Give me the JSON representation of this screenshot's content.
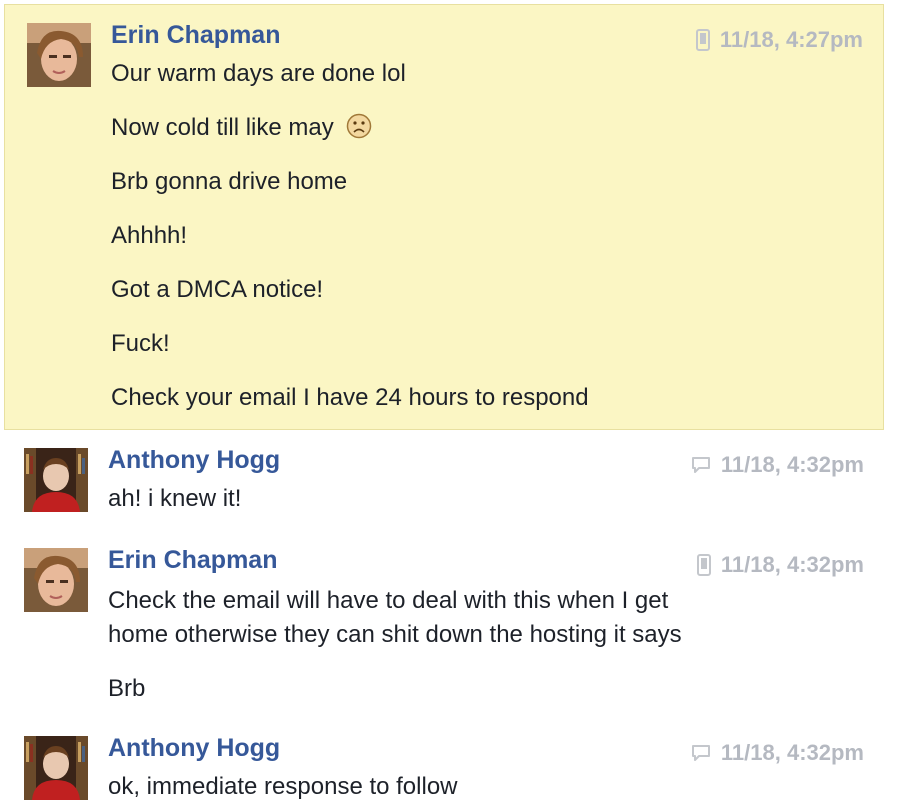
{
  "messages": [
    {
      "author": "Erin Chapman",
      "time": "11/18, 4:27pm",
      "source_icon": "phone-icon",
      "lines": [
        "Our warm days are done lol",
        "Now cold till like may",
        "Brb gonna drive home",
        "Ahhhh!",
        "Got a DMCA notice!",
        "Fuck!",
        "Check your email I have 24 hours to respond"
      ]
    },
    {
      "author": "Anthony Hogg",
      "time": "11/18, 4:32pm",
      "source_icon": "chat-bubble-icon",
      "lines": [
        "ah! i knew it!"
      ]
    },
    {
      "author": "Erin Chapman",
      "time": "11/18, 4:32pm",
      "source_icon": "phone-icon",
      "lines": [
        "Check the email will have to deal with this when I get",
        "home otherwise they can shit down the hosting it says",
        "Brb"
      ]
    },
    {
      "author": "Anthony Hogg",
      "time": "11/18, 4:32pm",
      "source_icon": "chat-bubble-icon",
      "lines": [
        "ok, immediate response to follow"
      ]
    }
  ],
  "colors": {
    "author_name": "#365899",
    "timestamp": "#b5b9c1",
    "highlight_bg": "#fbf6c4",
    "text": "#1d2129"
  }
}
